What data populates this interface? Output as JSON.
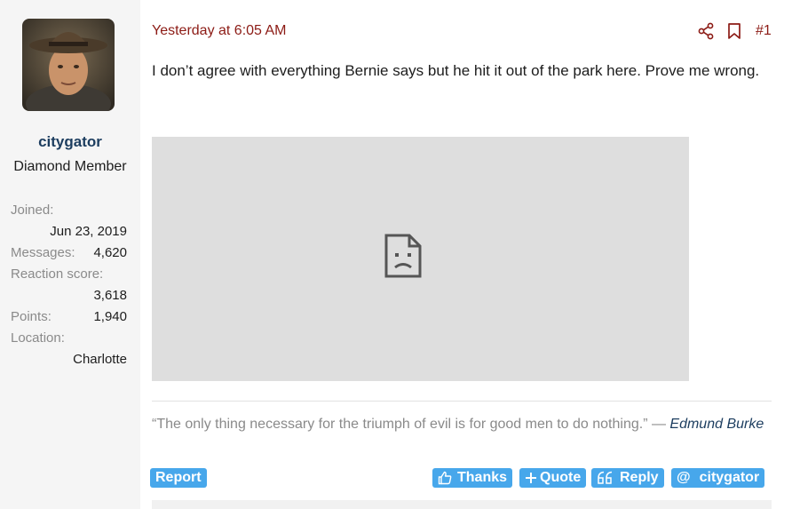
{
  "user": {
    "username": "citygator",
    "title": "Diamond Member",
    "stats": {
      "joined_label": "Joined:",
      "joined_value": "Jun 23, 2019",
      "messages_label": "Messages:",
      "messages_value": "4,620",
      "reaction_label": "Reaction score:",
      "reaction_value": "3,618",
      "points_label": "Points:",
      "points_value": "1,940",
      "location_label": "Location:",
      "location_value": "Charlotte"
    }
  },
  "post": {
    "timestamp": "Yesterday at 6:05 AM",
    "number": "#1",
    "body": "I don’t agree with everything Bernie says but he hit it out of the park here. Prove me wrong.",
    "signature_quote": "“The only thing necessary for the triumph of evil is for good men to do nothing.” — ",
    "signature_author": "Edmund Burke"
  },
  "actions": {
    "report": "Report",
    "thanks": "Thanks",
    "quote": "Quote",
    "reply": "Reply",
    "mention": "citygator"
  },
  "icons": {
    "share": "share-icon",
    "bookmark": "bookmark-icon",
    "broken_media": "broken-image-icon",
    "thumbs_up": "thumbs-up-icon",
    "plus": "plus-icon",
    "quote_mark": "quote-icon",
    "at": "at-icon"
  },
  "colors": {
    "accent_red": "#8c1b15",
    "button_blue": "#47a7eb",
    "username_navy": "#1c3d5f"
  }
}
